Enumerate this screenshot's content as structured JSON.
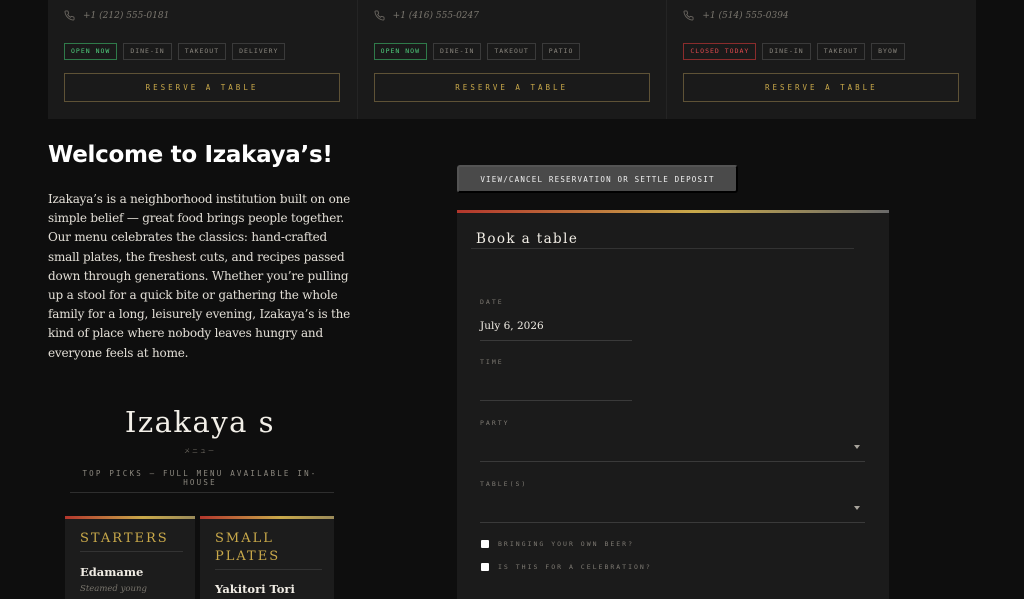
{
  "locations": [
    {
      "phone": "+1 (212) 555-0181",
      "tags": [
        {
          "label": "OPEN NOW",
          "status": "open"
        },
        {
          "label": "DINE-IN"
        },
        {
          "label": "TAKEOUT"
        },
        {
          "label": "DELIVERY"
        }
      ],
      "button": "RESERVE A TABLE"
    },
    {
      "phone": "+1 (416) 555-0247",
      "tags": [
        {
          "label": "OPEN NOW",
          "status": "open"
        },
        {
          "label": "DINE-IN"
        },
        {
          "label": "TAKEOUT"
        },
        {
          "label": "PATIO"
        }
      ],
      "button": "RESERVE A TABLE"
    },
    {
      "phone": "+1 (514) 555-0394",
      "tags": [
        {
          "label": "CLOSED TODAY",
          "status": "closed"
        },
        {
          "label": "DINE-IN"
        },
        {
          "label": "TAKEOUT"
        },
        {
          "label": "BYOW"
        }
      ],
      "button": "RESERVE A TABLE"
    }
  ],
  "welcome": {
    "title": "Welcome to Izakaya’s!",
    "body": "Izakaya’s is a neighborhood institution built on one simple belief — great food brings people together. Our menu celebrates the classics: hand-crafted small plates, the freshest cuts, and recipes passed down through generations. Whether you’re pulling up a stool for a quick bite or gathering the whole family for a long, leisurely evening, Izakaya’s is the kind of place where nobody leaves hungry and everyone feels at home."
  },
  "menu": {
    "logo": "Izakaya s",
    "glyphs": "メニュー",
    "tagline": "TOP PICKS — FULL MENU AVAILABLE IN-HOUSE",
    "columns": [
      {
        "title": "STARTERS",
        "item": "Edamame",
        "desc": "Steamed young"
      },
      {
        "title": "SMALL PLATES",
        "item": "Yakitori Tori",
        "desc": ""
      }
    ]
  },
  "booking": {
    "view_cancel_label": "VIEW/CANCEL RESERVATION OR SETTLE DEPOSIT",
    "title": "Book a table",
    "date_label": "DATE",
    "date_value": "July 6, 2026",
    "time_label": "TIME",
    "time_value": "",
    "party_label": "PARTY",
    "tables_label": "TABLE(S)",
    "byob_label": "BRINGING YOUR OWN BEER?",
    "celebration_label": "IS THIS FOR A CELEBRATION?"
  },
  "colors": {
    "accent_gold": "#c9a94a",
    "open_green": "#4fce7d",
    "closed_red": "#e0484c",
    "accent_red": "#b3362c"
  }
}
